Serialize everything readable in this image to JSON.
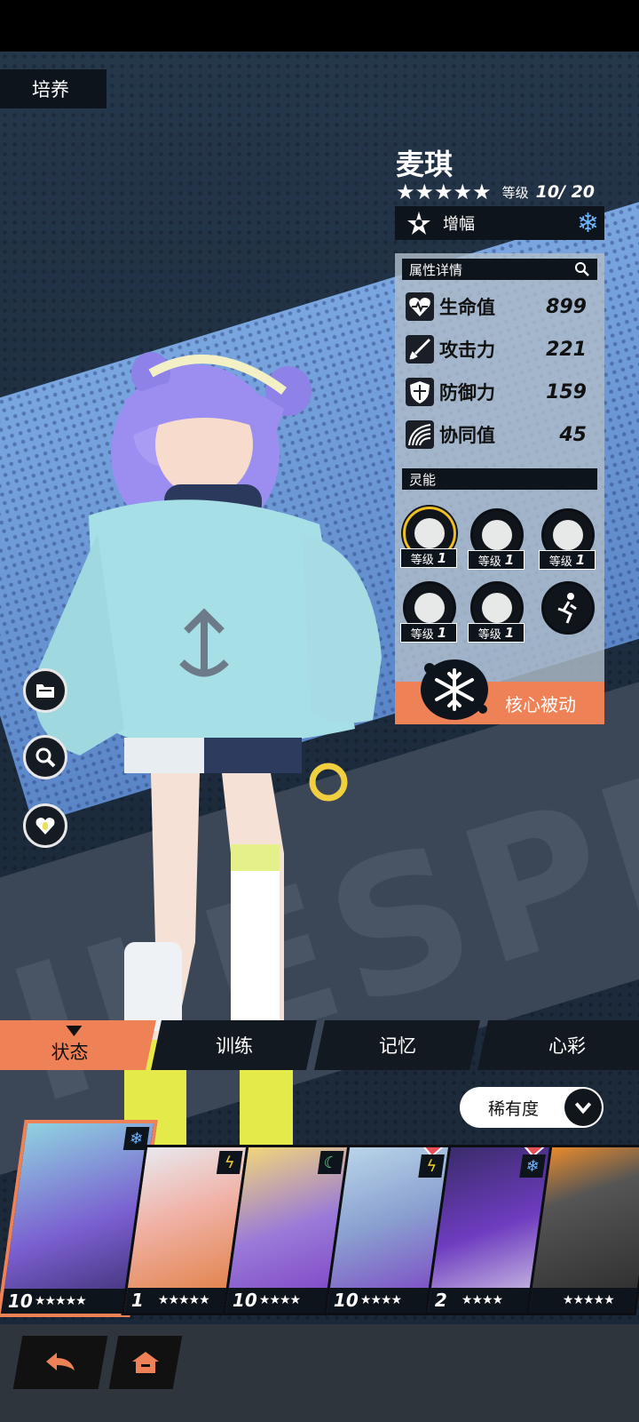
{
  "header": {
    "section": "培养"
  },
  "character": {
    "name": "麦琪",
    "stars": "★★★★★",
    "level_label": "等级",
    "level_value": "10/ 20",
    "amplify_label": "增幅"
  },
  "attributes": {
    "title": "属性详情",
    "items": [
      {
        "label": "生命值",
        "value": "899",
        "icon": "heart-icon"
      },
      {
        "label": "攻击力",
        "value": "221",
        "icon": "sword-icon"
      },
      {
        "label": "防御力",
        "value": "159",
        "icon": "shield-icon"
      },
      {
        "label": "协同值",
        "value": "45",
        "icon": "synergy-icon"
      }
    ]
  },
  "psi": {
    "title": "灵能",
    "skills": [
      {
        "level_label": "等级",
        "level": "1",
        "icon": "fish-icon",
        "selected": true
      },
      {
        "level_label": "等级",
        "level": "1",
        "icon": "popsicle-icon"
      },
      {
        "level_label": "等级",
        "level": "1",
        "icon": "gear-can-icon"
      },
      {
        "level_label": "等级",
        "level": "1",
        "icon": "splash-icon"
      },
      {
        "level_label": "等级",
        "level": "1",
        "icon": "anchor-icon"
      },
      {
        "icon": "running-figure-icon"
      }
    ]
  },
  "core_passive": {
    "label": "核心被动"
  },
  "tabs": [
    {
      "label": "状态",
      "active": true
    },
    {
      "label": "训练"
    },
    {
      "label": "记忆"
    },
    {
      "label": "心彩"
    }
  ],
  "sort": {
    "label": "稀有度"
  },
  "roster": [
    {
      "level": "10",
      "stars": "★★★★★",
      "element": "ice",
      "accent": "#7a5fd0"
    },
    {
      "level": "1",
      "stars": "★★★★★",
      "element": "thunder",
      "accent": "#e07a3a"
    },
    {
      "level": "10",
      "stars": "★★★★",
      "element": "wind",
      "accent": "#7b3fc4"
    },
    {
      "level": "10",
      "stars": "★★★★",
      "element": "thunder",
      "accent": "#7b3fc4"
    },
    {
      "level": "2",
      "stars": "★★★★",
      "element": "ice",
      "accent": "#6e3cc0"
    },
    {
      "level": "",
      "stars": "★★★★★",
      "element": "",
      "accent": "#e88a2c"
    }
  ],
  "colors": {
    "accent": "#ef8157",
    "panel": "#afbcc8",
    "ice": "#6fb4ff"
  }
}
